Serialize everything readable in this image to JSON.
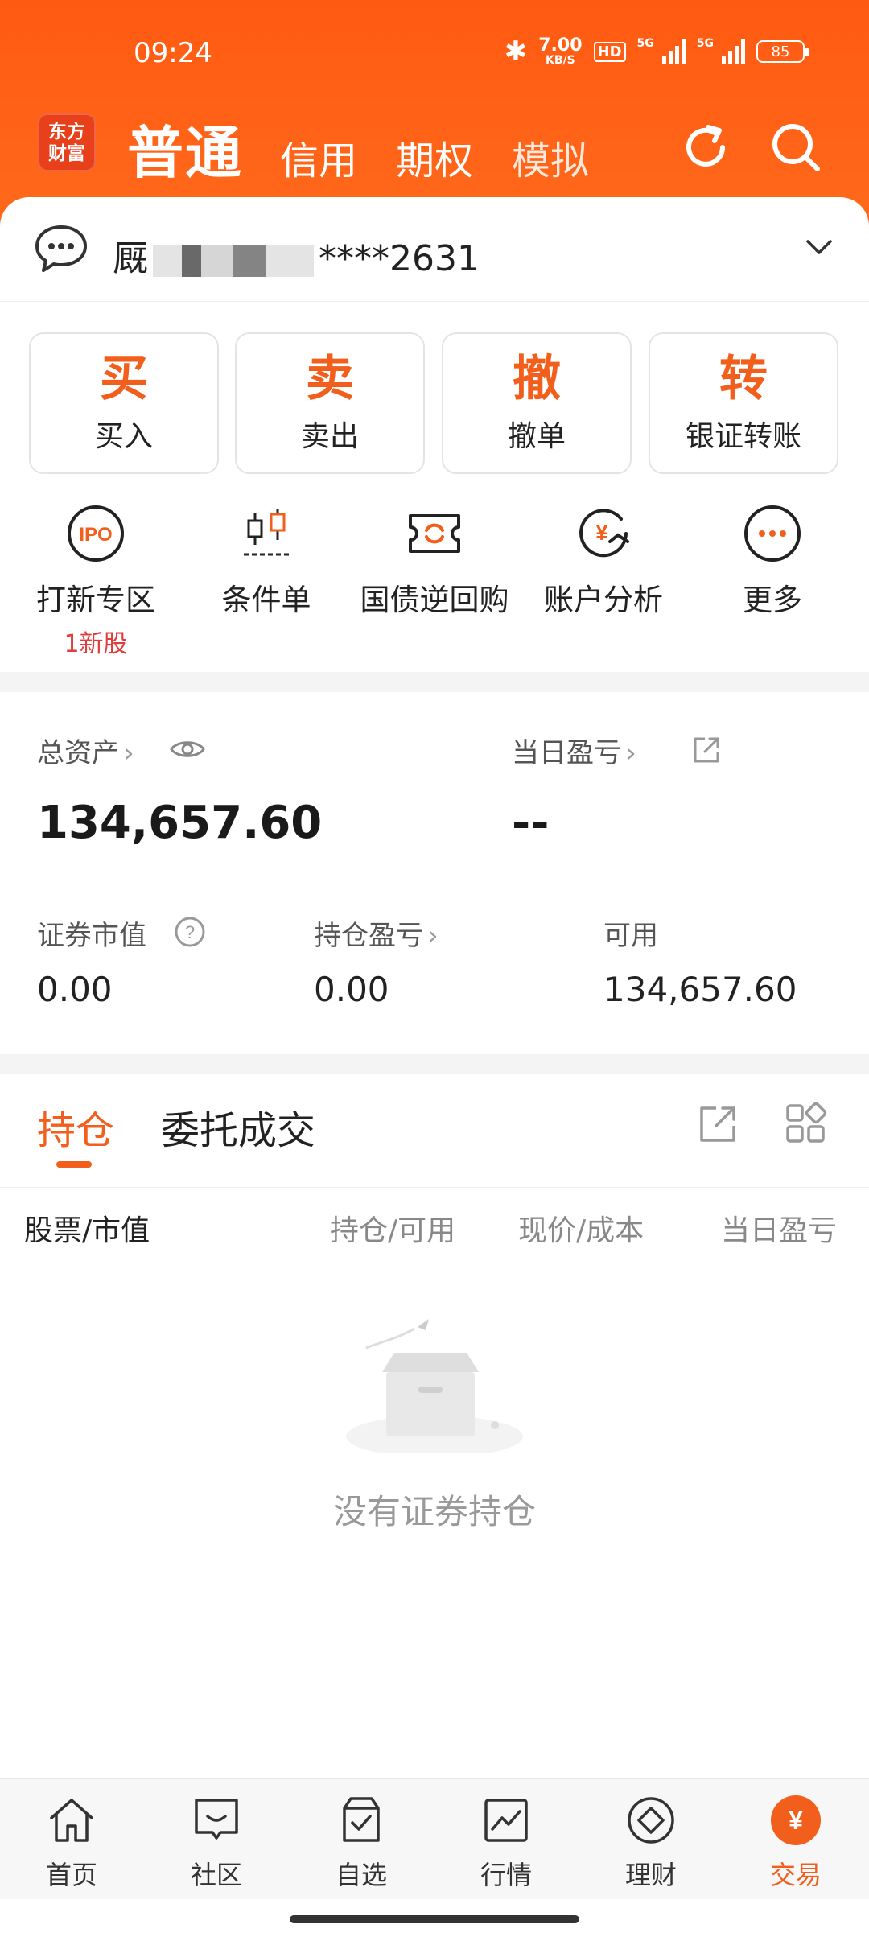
{
  "status_bar": {
    "time": "09:24",
    "speed_value": "7.00",
    "speed_unit": "KB/S",
    "hd": "HD",
    "net1": "5G",
    "net2": "5G",
    "battery": "85"
  },
  "header": {
    "logo_line1": "东方",
    "logo_line2": "财富",
    "tabs": [
      "普通",
      "信用",
      "期权",
      "模拟"
    ],
    "active_tab": "普通"
  },
  "account": {
    "masked_prefix": "厩",
    "masked_suffix": "****2631"
  },
  "actions": [
    {
      "icon_char": "买",
      "label": "买入"
    },
    {
      "icon_char": "卖",
      "label": "卖出"
    },
    {
      "icon_char": "撤",
      "label": "撤单"
    },
    {
      "icon_char": "转",
      "label": "银证转账"
    }
  ],
  "features": [
    {
      "icon": "ipo-icon",
      "icon_text": "IPO",
      "label": "打新专区",
      "sub": "1新股"
    },
    {
      "icon": "candlestick-icon",
      "label": "条件单"
    },
    {
      "icon": "ticket-icon",
      "label": "国债逆回购"
    },
    {
      "icon": "yen-analysis-icon",
      "label": "账户分析"
    },
    {
      "icon": "more-icon",
      "label": "更多"
    }
  ],
  "assets": {
    "total_label": "总资产",
    "total_value": "134,657.60",
    "daily_pl_label": "当日盈亏",
    "daily_pl_value": "--",
    "market_value_label": "证券市值",
    "market_value": "0.00",
    "holding_pl_label": "持仓盈亏",
    "holding_pl": "0.00",
    "available_label": "可用",
    "available": "134,657.60"
  },
  "holdings": {
    "tabs": [
      "持仓",
      "委托成交"
    ],
    "columns": [
      "股票/市值",
      "持仓/可用",
      "现价/成本",
      "当日盈亏"
    ],
    "empty_text": "没有证券持仓"
  },
  "bottom_nav": [
    {
      "icon": "home-icon",
      "label": "首页"
    },
    {
      "icon": "community-icon",
      "label": "社区"
    },
    {
      "icon": "watchlist-icon",
      "label": "自选"
    },
    {
      "icon": "market-icon",
      "label": "行情"
    },
    {
      "icon": "wealth-icon",
      "label": "理财"
    },
    {
      "icon": "trade-icon",
      "label": "交易",
      "active": true,
      "icon_char": "¥"
    }
  ],
  "colors": {
    "brand": "#ff5a12",
    "accent": "#f25f1c",
    "negative": "#e23b3b"
  }
}
